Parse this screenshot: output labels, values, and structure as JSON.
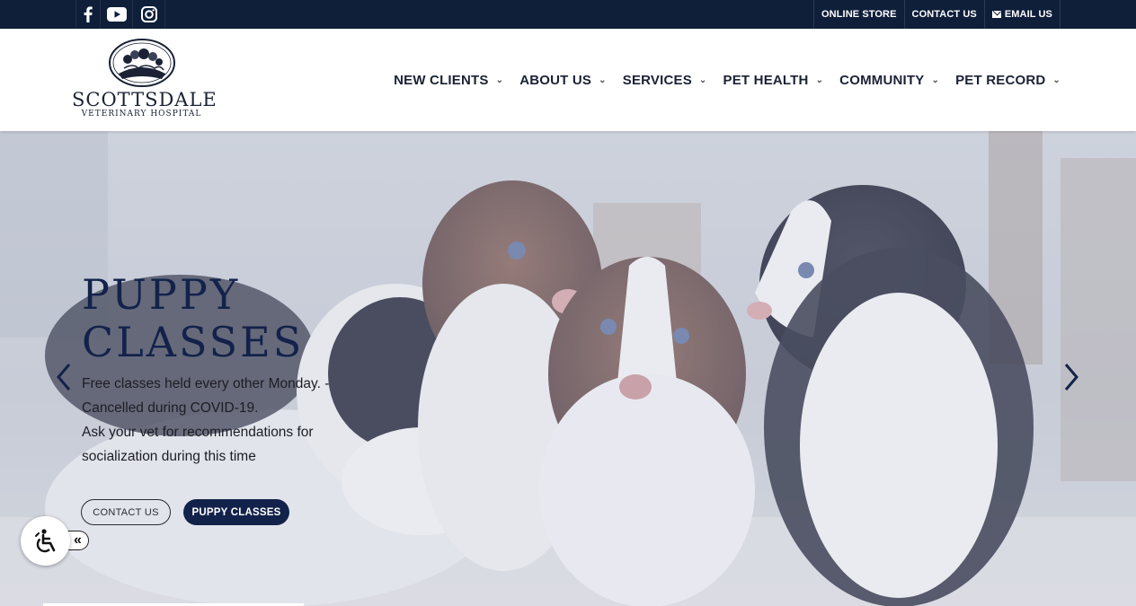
{
  "topbar": {
    "social": [
      {
        "icon": "facebook-icon"
      },
      {
        "icon": "youtube-icon"
      },
      {
        "icon": "instagram-icon"
      }
    ],
    "links": {
      "online_store": "ONLINE STORE",
      "contact_us": "CONTACT US",
      "email_us": "EMAIL US"
    },
    "bg_color": "#0f1f3a"
  },
  "logo": {
    "name": "SCOTTSDALE",
    "sub": "VETERINARY HOSPITAL"
  },
  "nav": {
    "items": [
      {
        "label": "NEW CLIENTS"
      },
      {
        "label": "ABOUT US"
      },
      {
        "label": "SERVICES"
      },
      {
        "label": "PET HEALTH"
      },
      {
        "label": "COMMUNITY"
      },
      {
        "label": "PET RECORD"
      }
    ]
  },
  "hero": {
    "title_line1": "PUPPY",
    "title_line2": "CLASSES",
    "text_line1": "Free classes held every other Monday. -",
    "text_line2": "Cancelled during COVID-19.",
    "text_line3": "Ask your vet for recommendations for",
    "text_line4": "socialization during this time",
    "btn_contact": "CONTACT US",
    "btn_puppy": "PUPPY CLASSES",
    "accent_color": "#13224a"
  },
  "a11y": {
    "toggle": "«",
    "icon": "wheelchair-icon"
  }
}
